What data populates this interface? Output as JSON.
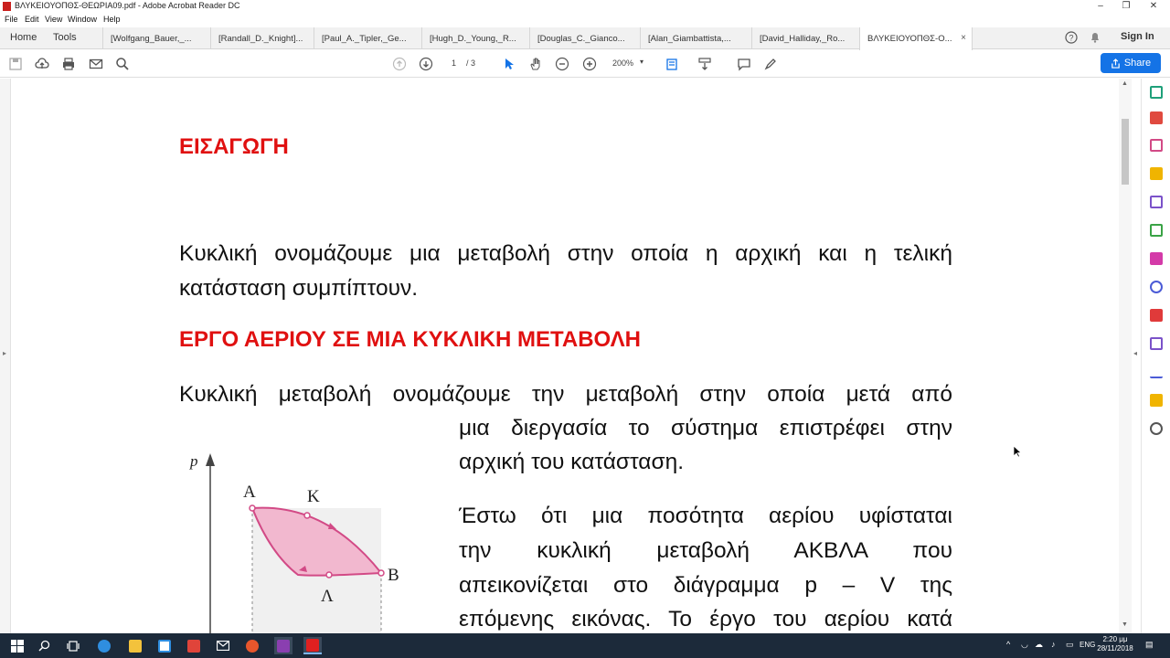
{
  "window": {
    "title": "ΒΛΥΚΕΙΟΥΟΠΘΣ-ΘΕΩΡΙΑ09.pdf - Adobe Acrobat Reader DC",
    "minimize": "–",
    "restore": "❐",
    "close": "✕"
  },
  "menu": {
    "file": "File",
    "edit": "Edit",
    "view": "View",
    "window": "Window",
    "help": "Help"
  },
  "tabs": {
    "home": "Home",
    "tools": "Tools",
    "documents": [
      "[Wolfgang_Bauer,_...",
      "[Randall_D._Knight]...",
      "[Paul_A._Tipler,_Ge...",
      "[Hugh_D._Young,_R...",
      "[Douglas_C._Gianco...",
      "[Alan_Giambattista,...",
      "[David_Halliday,_Ro...",
      "ΒΛΥΚΕΙΟΥΟΠΘΣ-Ο..."
    ],
    "close_symbol": "×",
    "signin": "Sign In"
  },
  "toolbar": {
    "page_current": "1",
    "page_total": "/ 3",
    "zoom": "200%",
    "share": "Share"
  },
  "document": {
    "heading1": "ΕΙΣΑΓΩΓΗ",
    "para1_line1": "Κυκλική ονομάζουμε μια μεταβολή στην οποία η αρχική και η τελική",
    "para1_line2": "κατάσταση συμπίπτουν.",
    "heading2": "ΕΡΓΟ ΑΕΡΙΟΥ ΣΕ ΜΙΑ ΚΥΚΛΙΚΗ ΜΕΤΑΒΟΛΗ",
    "para2_line1": "Κυκλική μεταβολή ονομάζουμε την μεταβολή στην οποία μετά από",
    "para2_line2": "μια διεργασία το σύστημα επιστρέφει στην",
    "para2_line3": "αρχική του κατάσταση.",
    "para3_line1": "Έστω ότι μια ποσότητα αερίου υφίσταται",
    "para3_line2": "την κυκλική μεταβολή ΑΚΒΛΑ που",
    "para3_line3": "απεικονίζεται στο διάγραμμα p – V της",
    "para3_line4": "επόμενης εικόνας. Το έργο του αερίου κατά",
    "diagram": {
      "axis_label": "p",
      "point_a": "A",
      "point_k": "K",
      "point_b": "B",
      "point_l": "Λ"
    }
  },
  "taskbar": {
    "language": "ENG",
    "time": "2:20 μμ",
    "date": "28/11/2018"
  },
  "colors": {
    "heading_red": "#e01010",
    "acrobat_blue": "#1473e6",
    "taskbar_bg": "#1c2a3a",
    "cycle_fill": "#f2b8cf",
    "cycle_stroke": "#d24a86"
  }
}
